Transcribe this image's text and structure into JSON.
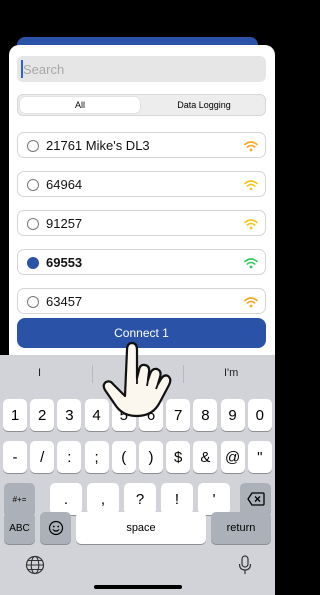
{
  "search": {
    "placeholder": "Search",
    "value": ""
  },
  "tabs": [
    {
      "label": "All",
      "selected": true
    },
    {
      "label": "Data Logging",
      "selected": false
    }
  ],
  "devices": [
    {
      "name": "21761 Mike's DL3",
      "selected": false,
      "signal_color": "#f5a623"
    },
    {
      "name": "64964",
      "selected": false,
      "signal_color": "#f5c518"
    },
    {
      "name": "91257",
      "selected": false,
      "signal_color": "#f5c518"
    },
    {
      "name": "69553",
      "selected": true,
      "signal_color": "#34c759"
    },
    {
      "name": "63457",
      "selected": false,
      "signal_color": "#f5a623"
    }
  ],
  "connect_label": "Connect 1",
  "keyboard": {
    "suggestions": [
      "I",
      "I'm"
    ],
    "row1": [
      "1",
      "2",
      "3",
      "4",
      "5",
      "6",
      "7",
      "8",
      "9",
      "0"
    ],
    "row2": [
      "-",
      "/",
      ":",
      ";",
      "(",
      ")",
      "$",
      "&",
      "@",
      "\""
    ],
    "row3_mode": "#+=",
    "row3": [
      ".",
      ",",
      "?",
      "!",
      "'"
    ],
    "abc": "ABC",
    "space": "space",
    "return": "return"
  },
  "colors": {
    "accent": "#2a53a8",
    "keyboard_bg": "#d1d3d9"
  },
  "icons": {
    "emoji": "emoji-icon",
    "globe": "globe-icon",
    "mic": "microphone-icon",
    "backspace": "backspace-icon",
    "wifi": "wifi-icon",
    "hand": "hand-pointer-icon"
  }
}
